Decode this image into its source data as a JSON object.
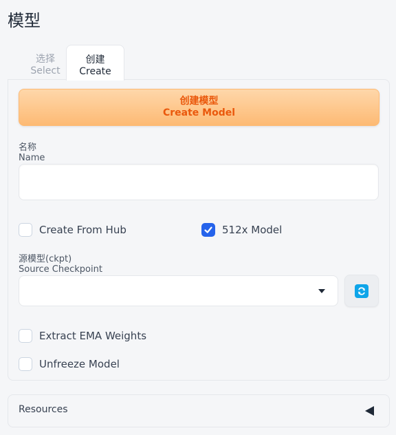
{
  "page": {
    "title": "模型"
  },
  "tabs": [
    {
      "label_cn": "选择",
      "label_en": "Select",
      "active": false
    },
    {
      "label_cn": "创建",
      "label_en": "Create",
      "active": true
    }
  ],
  "create_button": {
    "label_cn": "创建模型",
    "label_en": "Create Model"
  },
  "name_field": {
    "label_cn": "名称",
    "label_en": "Name",
    "value": "",
    "placeholder": ""
  },
  "checkboxes": {
    "create_from_hub": {
      "label": "Create From Hub",
      "checked": false
    },
    "model_512x": {
      "label": "512x Model",
      "checked": true
    },
    "extract_ema": {
      "label": "Extract EMA Weights",
      "checked": false
    },
    "unfreeze": {
      "label": "Unfreeze Model",
      "checked": false
    }
  },
  "source_checkpoint": {
    "label_cn": "源模型(ckpt)",
    "label_en": "Source Checkpoint",
    "value": ""
  },
  "icons": {
    "refresh": "refresh-icon",
    "dropdown_caret": "chevron-down-icon",
    "collapse": "triangle-left-icon",
    "check": "check-icon"
  },
  "resources": {
    "label": "Resources",
    "expanded": false
  },
  "colors": {
    "accent_orange": "#ea580c",
    "button_gradient_top": "#fed7aa",
    "button_gradient_bottom": "#fdba74",
    "checkbox_blue": "#2563eb",
    "refresh_blue": "#0ea5e9"
  }
}
